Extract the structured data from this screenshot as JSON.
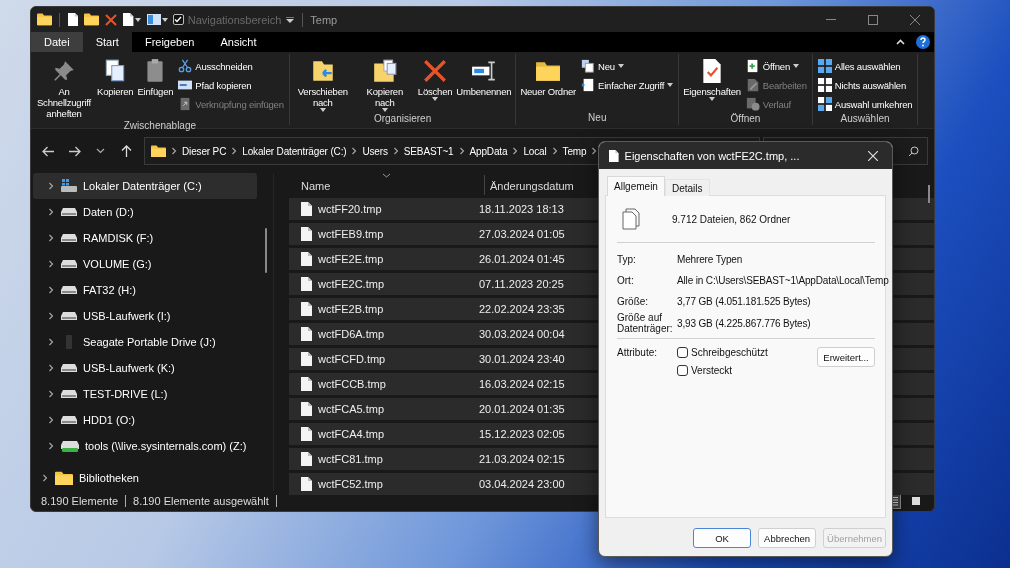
{
  "window": {
    "title": "Temp",
    "quick_access": {
      "label": "Navigationsbereich",
      "checked": true
    }
  },
  "ribbon_tabs": [
    {
      "label": "Datei",
      "kind": "file",
      "selected": false
    },
    {
      "label": "Start",
      "kind": "tab",
      "selected": true
    },
    {
      "label": "Freigeben",
      "kind": "tab",
      "selected": false
    },
    {
      "label": "Ansicht",
      "kind": "tab",
      "selected": false
    }
  ],
  "ribbon_groups": [
    {
      "label": "Zwischenablage",
      "commands": [
        {
          "label": "An Schnellzugriff anheften",
          "kind": "large",
          "dropdown": false,
          "disabled": false
        },
        {
          "label": "Kopieren",
          "kind": "large",
          "dropdown": false,
          "disabled": false
        },
        {
          "label": "Einfügen",
          "kind": "large",
          "dropdown": false,
          "disabled": false
        },
        {
          "label": "Ausschneiden",
          "kind": "small",
          "dropdown": false,
          "disabled": false
        },
        {
          "label": "Pfad kopieren",
          "kind": "small",
          "dropdown": false,
          "disabled": false
        },
        {
          "label": "Verknüpfung einfügen",
          "kind": "small",
          "dropdown": false,
          "disabled": true
        }
      ]
    },
    {
      "label": "Organisieren",
      "commands": [
        {
          "label": "Verschieben nach",
          "kind": "large",
          "dropdown": true,
          "disabled": false
        },
        {
          "label": "Kopieren nach",
          "kind": "large",
          "dropdown": true,
          "disabled": false
        },
        {
          "label": "Löschen",
          "kind": "large",
          "dropdown": true,
          "disabled": false
        },
        {
          "label": "Umbenennen",
          "kind": "large",
          "dropdown": false,
          "disabled": false
        }
      ]
    },
    {
      "label": "Neu",
      "commands": [
        {
          "label": "Neuer Ordner",
          "kind": "large",
          "dropdown": false,
          "disabled": false
        },
        {
          "label": "Neu",
          "kind": "small",
          "dropdown": true,
          "disabled": false
        },
        {
          "label": "Einfacher Zugriff",
          "kind": "small",
          "dropdown": true,
          "disabled": false
        }
      ]
    },
    {
      "label": "Öffnen",
      "commands": [
        {
          "label": "Eigenschaften",
          "kind": "large",
          "dropdown": true,
          "disabled": false
        },
        {
          "label": "Öffnen",
          "kind": "small",
          "dropdown": true,
          "disabled": false
        },
        {
          "label": "Bearbeiten",
          "kind": "small",
          "dropdown": false,
          "disabled": true
        },
        {
          "label": "Verlauf",
          "kind": "small",
          "dropdown": false,
          "disabled": true
        }
      ]
    },
    {
      "label": "Auswählen",
      "commands": [
        {
          "label": "Alles auswählen",
          "kind": "small",
          "dropdown": false,
          "disabled": false
        },
        {
          "label": "Nichts auswählen",
          "kind": "small",
          "dropdown": false,
          "disabled": false
        },
        {
          "label": "Auswahl umkehren",
          "kind": "small",
          "dropdown": false,
          "disabled": false
        }
      ]
    }
  ],
  "address": {
    "path": [
      "Dieser PC",
      "Lokaler Datenträger (C:)",
      "Users",
      "SEBAST~1",
      "AppData",
      "Local",
      "Temp"
    ]
  },
  "sidebar": {
    "items": [
      {
        "label": "Lokaler Datenträger (C:)",
        "kind": "system",
        "expanded": false,
        "selected": true
      },
      {
        "label": "Daten (D:)",
        "kind": "drive",
        "expanded": false,
        "selected": false
      },
      {
        "label": "RAMDISK (F:)",
        "kind": "drive",
        "expanded": false,
        "selected": false
      },
      {
        "label": "VOLUME (G:)",
        "kind": "drive",
        "expanded": false,
        "selected": false
      },
      {
        "label": "FAT32 (H:)",
        "kind": "drive",
        "expanded": false,
        "selected": false
      },
      {
        "label": "USB-Laufwerk (I:)",
        "kind": "drive",
        "expanded": false,
        "selected": false
      },
      {
        "label": "Seagate Portable Drive (J:)",
        "kind": "external",
        "expanded": false,
        "selected": false
      },
      {
        "label": "USB-Laufwerk (K:)",
        "kind": "drive",
        "expanded": false,
        "selected": false
      },
      {
        "label": "TEST-DRIVE (L:)",
        "kind": "drive",
        "expanded": false,
        "selected": false
      },
      {
        "label": "HDD1 (O:)",
        "kind": "drive",
        "expanded": false,
        "selected": false
      },
      {
        "label": "tools (\\\\live.sysinternals.com) (Z:)",
        "kind": "network",
        "expanded": false,
        "selected": false
      }
    ],
    "root_items": [
      {
        "label": "Bibliotheken",
        "kind": "library",
        "expanded": false,
        "selected": false
      }
    ]
  },
  "file_list": {
    "columns": [
      "Name",
      "Änderungsdatum"
    ],
    "rows": [
      {
        "name": "wctFF20.tmp",
        "modified": "18.11.2023 18:13",
        "selected": true
      },
      {
        "name": "wctFEB9.tmp",
        "modified": "27.03.2024 01:05",
        "selected": true
      },
      {
        "name": "wctFE2E.tmp",
        "modified": "26.01.2024 01:45",
        "selected": true
      },
      {
        "name": "wctFE2C.tmp",
        "modified": "07.11.2023 20:25",
        "selected": true
      },
      {
        "name": "wctFE2B.tmp",
        "modified": "22.02.2024 23:35",
        "selected": true
      },
      {
        "name": "wctFD6A.tmp",
        "modified": "30.03.2024 00:04",
        "selected": true
      },
      {
        "name": "wctFCFD.tmp",
        "modified": "30.01.2024 23:40",
        "selected": true
      },
      {
        "name": "wctFCCB.tmp",
        "modified": "16.03.2024 02:15",
        "selected": true
      },
      {
        "name": "wctFCA5.tmp",
        "modified": "20.01.2024 01:35",
        "selected": true
      },
      {
        "name": "wctFCA4.tmp",
        "modified": "15.12.2023 02:05",
        "selected": true
      },
      {
        "name": "wctFC81.tmp",
        "modified": "21.03.2024 02:15",
        "selected": true
      },
      {
        "name": "wctFC52.tmp",
        "modified": "03.04.2024 23:00",
        "selected": true
      }
    ]
  },
  "status_bar": {
    "items": [
      "8.190 Elemente",
      "8.190 Elemente ausgewählt"
    ],
    "view_buttons": [
      {
        "kind": "details",
        "selected": true
      },
      {
        "kind": "tiles",
        "selected": false
      }
    ]
  },
  "dialog": {
    "title": "Eigenschaften von wctFE2C.tmp, ...",
    "tabs": [
      {
        "label": "Allgemein",
        "selected": true
      },
      {
        "label": "Details",
        "selected": false
      }
    ],
    "summary": "9.712 Dateien, 862 Ordner",
    "properties": [
      {
        "label": "Typ:",
        "value": "Mehrere Typen"
      },
      {
        "label": "Ort:",
        "value": "Alle in C:\\Users\\SEBAST~1\\AppData\\Local\\Temp"
      },
      {
        "label": "Größe:",
        "value": "3,77 GB (4.051.181.525 Bytes)"
      },
      {
        "label": "Größe auf Datenträger:",
        "value": "3,93 GB (4.225.867.776 Bytes)"
      }
    ],
    "attributes": {
      "label": "Attribute:",
      "options": [
        {
          "label": "Schreibgeschützt",
          "checked": false
        },
        {
          "label": "Versteckt",
          "checked": false
        }
      ],
      "advanced": "Erweitert..."
    },
    "buttons": [
      {
        "label": "OK",
        "default": true,
        "disabled": false
      },
      {
        "label": "Abbrechen",
        "default": false,
        "disabled": false
      },
      {
        "label": "Übernehmen",
        "default": false,
        "disabled": true
      }
    ]
  }
}
